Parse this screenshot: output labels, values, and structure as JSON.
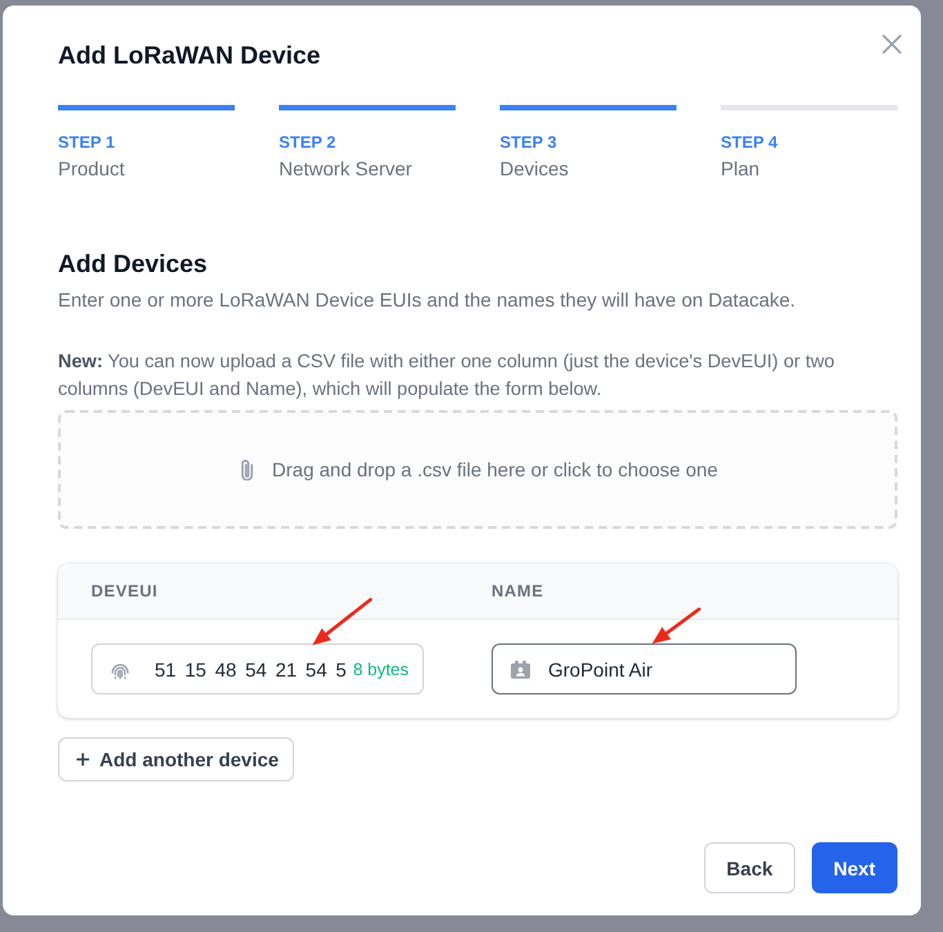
{
  "dialog": {
    "title": "Add LoRaWAN Device"
  },
  "steps": [
    {
      "label": "STEP 1",
      "name": "Product",
      "completed": true
    },
    {
      "label": "STEP 2",
      "name": "Network Server",
      "completed": true
    },
    {
      "label": "STEP 3",
      "name": "Devices",
      "completed": true
    },
    {
      "label": "STEP 4",
      "name": "Plan",
      "completed": false
    }
  ],
  "section": {
    "title": "Add Devices",
    "description": "Enter one or more LoRaWAN Device EUIs and the names they will have on Datacake.",
    "note": "**New:** You can now upload a CSV file with either one column (just the device's DevEUI) or two columns (DevEUI and Name), which will populate the form below."
  },
  "dropzone": {
    "text": "Drag and drop a .csv file here or click to choose one"
  },
  "table": {
    "columns": [
      "DEVEUI",
      "NAME"
    ],
    "rows": [
      {
        "deveui": {
          "value": "51 15 48 54 21 54 5",
          "byte_count": "8 bytes",
          "focused": false,
          "arrow": true
        },
        "name": {
          "value": "GroPoint Air",
          "focused": true,
          "arrow": true
        }
      }
    ]
  },
  "add_button": {
    "label": "Add another device"
  },
  "footer": {
    "buttons": [
      {
        "label": "Back",
        "kind": "secondary"
      },
      {
        "label": "Next",
        "kind": "primary"
      }
    ]
  }
}
